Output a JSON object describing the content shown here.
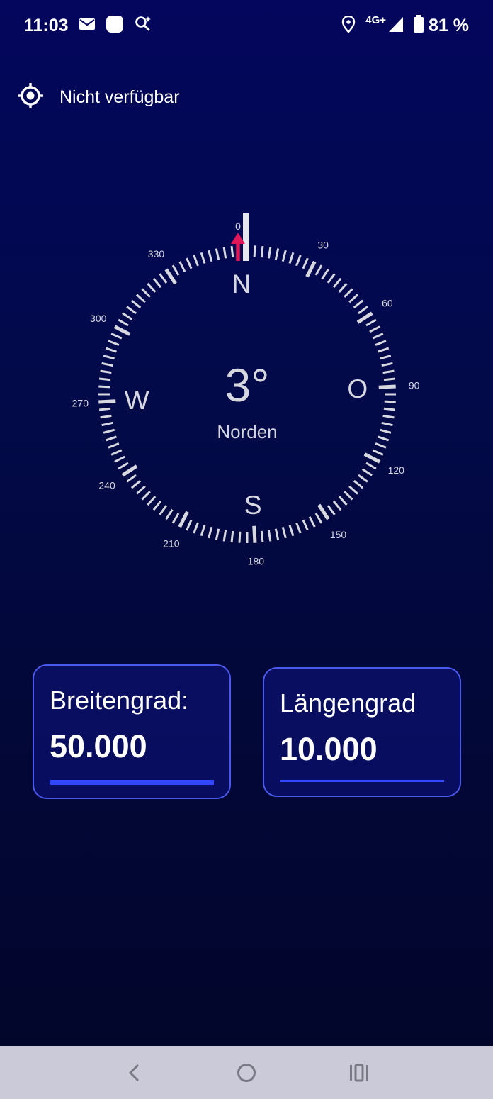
{
  "status_bar": {
    "time": "11:03",
    "network": "4G+",
    "battery": "81 %"
  },
  "location": {
    "status": "Nicht verfügbar"
  },
  "compass": {
    "heading_degrees": 3,
    "heading_display": "3°",
    "direction_name": "Norden",
    "cardinals": [
      "N",
      "O",
      "S",
      "W"
    ],
    "degree_labels": [
      "0",
      "30",
      "60",
      "90",
      "120",
      "150",
      "180",
      "210",
      "240",
      "270",
      "300",
      "330"
    ],
    "needle_color": "#e0185a",
    "tick_color": "#d8d8e0"
  },
  "latitude_card": {
    "label": "Breitengrad:",
    "value": "50.000"
  },
  "longitude_card": {
    "label": "Längengrad",
    "value": "10.000"
  },
  "nav_bar": {
    "back_icon": "back-chevron",
    "home_icon": "home-circle",
    "recents_icon": "recents-bars"
  }
}
